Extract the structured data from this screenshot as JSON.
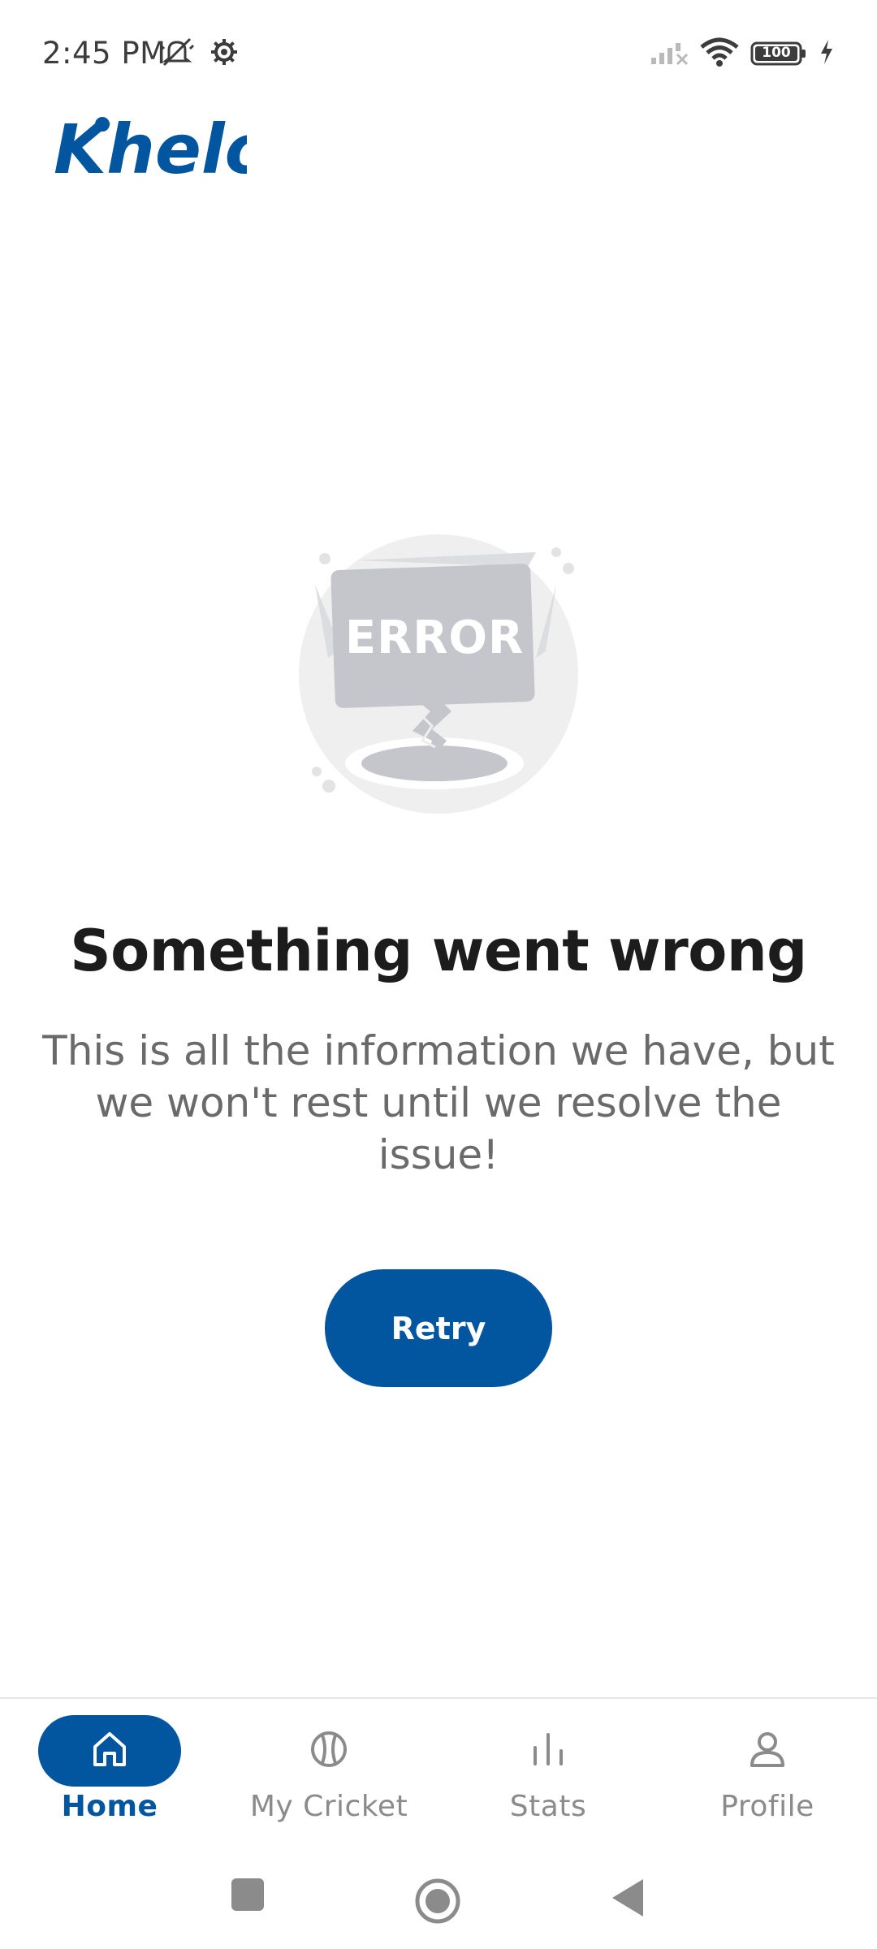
{
  "status_bar": {
    "time": "2:45 PM",
    "left_icons": [
      "mute-icon",
      "settings-gear-icon"
    ],
    "right_icons": [
      "signal-icon",
      "wifi-icon",
      "battery-icon",
      "charging-icon"
    ],
    "battery": "100"
  },
  "header": {
    "logo_text": "Khelo",
    "brand_color": "#02559f"
  },
  "error": {
    "illustration_text": "ERROR",
    "title": "Something went wrong",
    "message": "This is all the information we have, but we won't rest until we resolve the issue!",
    "retry_label": "Retry"
  },
  "bottom_nav": {
    "items": [
      {
        "label": "Home",
        "icon": "home-icon",
        "active": true
      },
      {
        "label": "My Cricket",
        "icon": "cricket-ball-icon",
        "active": false
      },
      {
        "label": "Stats",
        "icon": "stats-icon",
        "active": false
      },
      {
        "label": "Profile",
        "icon": "profile-icon",
        "active": false
      }
    ]
  },
  "system_nav": {
    "buttons": [
      "recents-icon",
      "home-circle-icon",
      "back-icon"
    ]
  }
}
